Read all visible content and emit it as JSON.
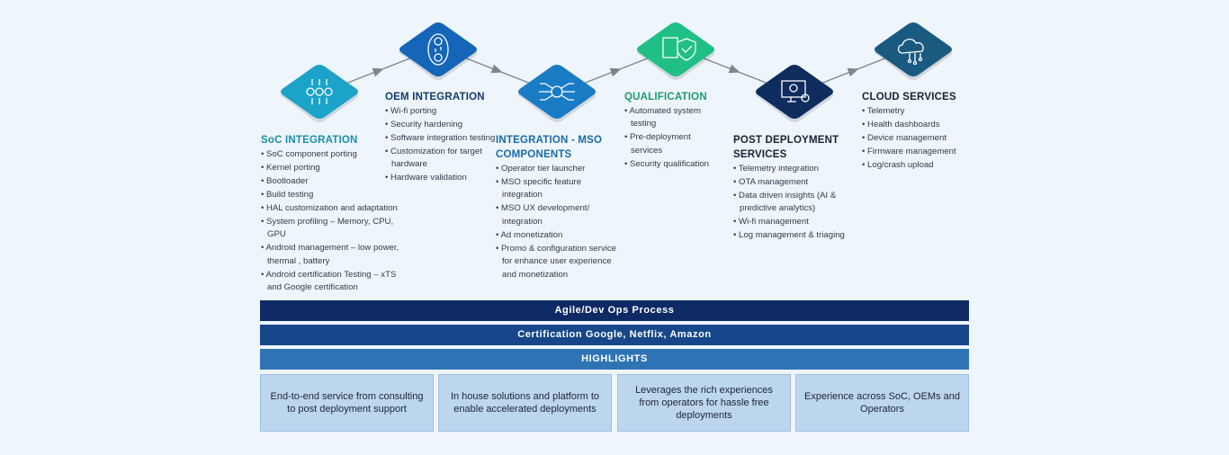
{
  "stages": [
    {
      "title": "SoC INTEGRATION",
      "icon": "gears-arrows-icon",
      "color": "#1ba3c8",
      "title_color": "#1a8fa8",
      "items": [
        "SoC component porting",
        "Kernel porting",
        "Bootloader",
        "Build testing",
        "HAL customization and adaptation",
        "System profiling – Memory, CPU, GPU",
        "Android management – low power, thermal , battery",
        "Android certification Testing – xTS and Google certification"
      ]
    },
    {
      "title": "OEM INTEGRATION",
      "icon": "gear-cycle-icon",
      "color": "#1565b8",
      "title_color": "#123a6b",
      "items": [
        "Wi-fi porting",
        "Security hardening",
        "Software integration testing",
        "Customization for target hardware",
        "Hardware validation"
      ]
    },
    {
      "title": "INTEGRATION - MSO COMPONENTS",
      "icon": "gear-circuit-icon",
      "color": "#1a7cc4",
      "title_color": "#1a6aa8",
      "items": [
        "Operator tier launcher",
        "MSO specific feature integration",
        "MSO UX development/ integration",
        "Ad monetization",
        "Promo & configuration service for enhance user experience and monetization"
      ]
    },
    {
      "title": "QUALIFICATION",
      "icon": "shield-check-icon",
      "color": "#1fbf85",
      "title_color": "#1f9a6e",
      "items": [
        "Automated  system testing",
        "Pre-deployment services",
        "Security qualification"
      ]
    },
    {
      "title": "POST DEPLOYMENT SERVICES",
      "icon": "monitor-gear-icon",
      "color": "#0f2c5e",
      "title_color": "#1a2233",
      "items": [
        "Telemetry integration",
        "OTA management",
        "Data driven insights (AI & predictive analytics)",
        "Wi-fi management",
        "Log management & triaging"
      ]
    },
    {
      "title": "CLOUD SERVICES",
      "icon": "cloud-network-icon",
      "color": "#1b5a80",
      "title_color": "#1a2233",
      "items": [
        "Telemetry",
        "Health dashboards",
        "Device management",
        "Firmware management",
        "Log/crash upload"
      ]
    }
  ],
  "bars": {
    "agile": "Agile/Dev Ops Process",
    "certification": "Certification Google, Netflix, Amazon",
    "highlights": "HIGHLIGHTS"
  },
  "highlights": [
    "End-to-end service from consulting to post deployment support",
    "In house solutions and platform to enable accelerated deployments",
    "Leverages the rich experiences from operators for hassle free deployments",
    "Experience across SoC, OEMs and Operators"
  ],
  "colors": {
    "background": "#eef5fb",
    "agile_bar": "#0e2a64",
    "cert_bar": "#17478a",
    "highlights_bar": "#2e74b5",
    "highlight_box": "#bcd6ee"
  }
}
